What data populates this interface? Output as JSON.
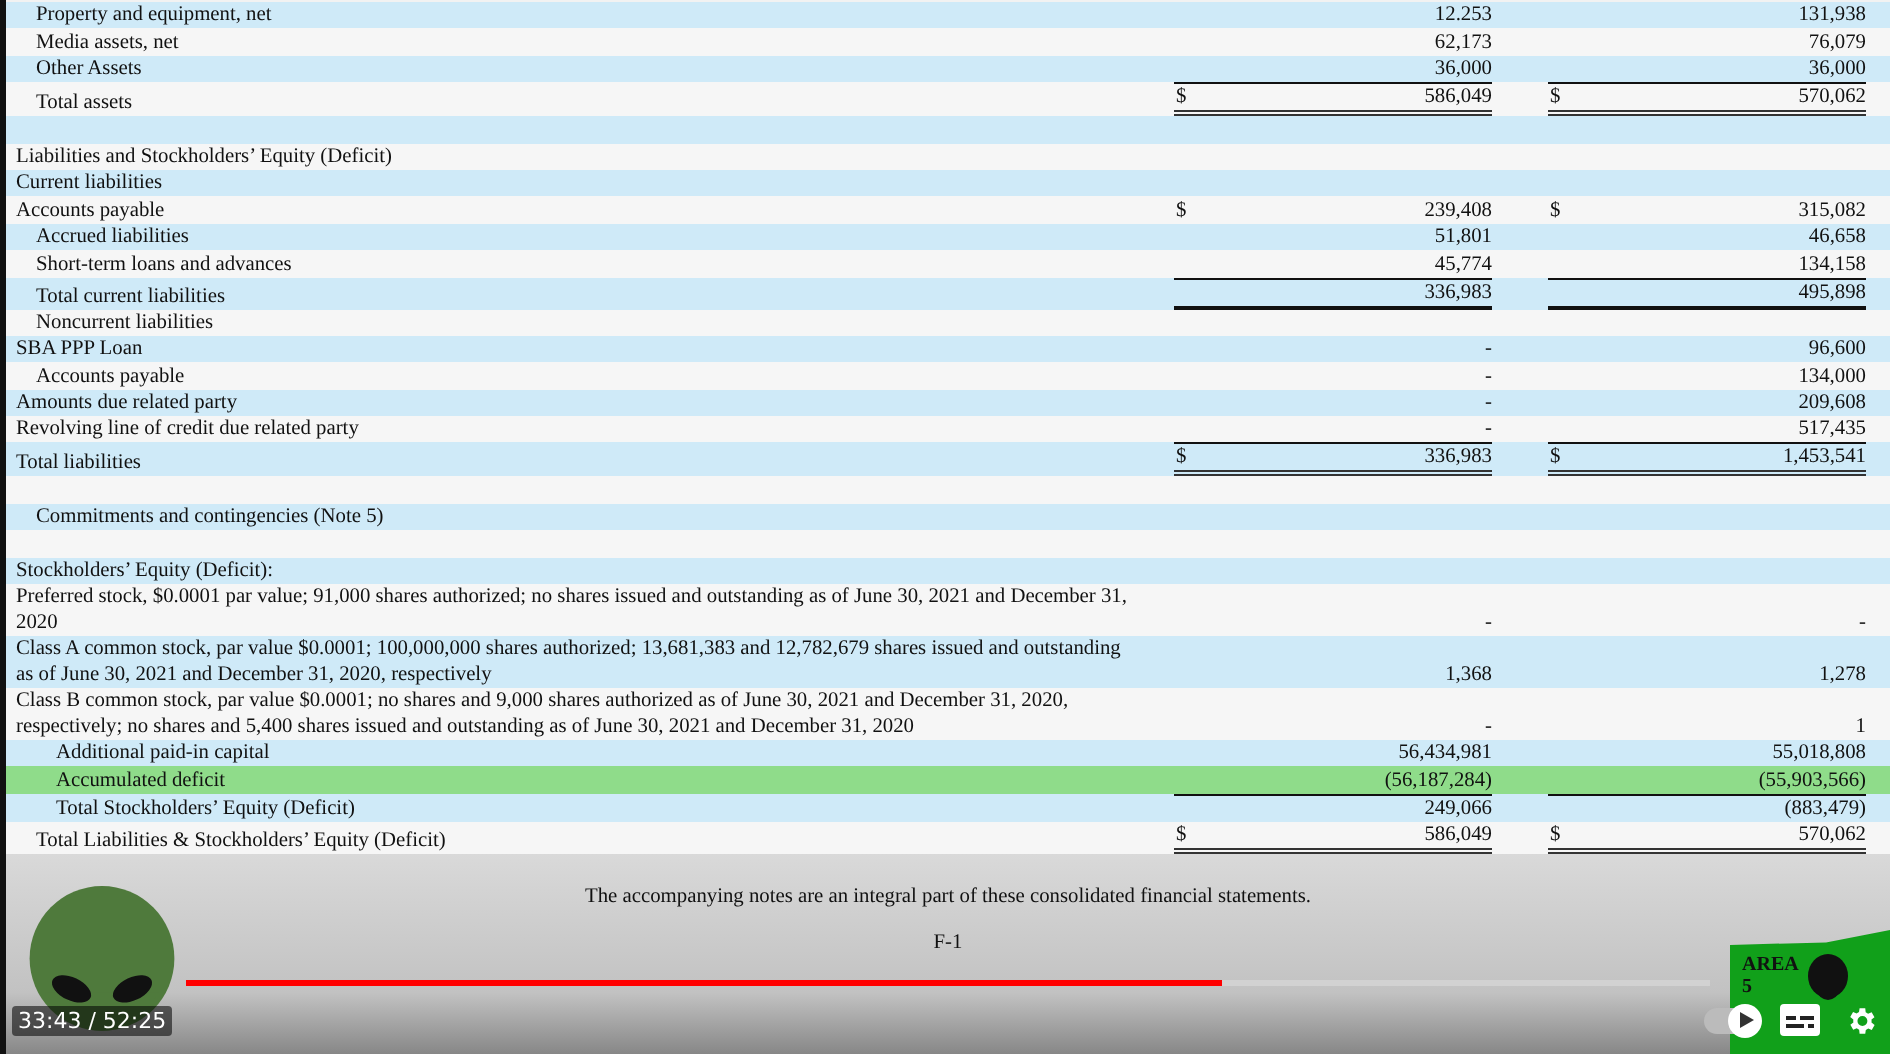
{
  "statement": {
    "rows": [
      {
        "kind": "item",
        "label": "Property and equipment, net",
        "band": true,
        "highlighted": false,
        "col_1": {
          "value": "12.253",
          "rule_above": false,
          "rule_below": false,
          "double_underline": false
        },
        "col_2": {
          "value": "131,938",
          "rule_above": false,
          "rule_below": false,
          "double_underline": false
        }
      },
      {
        "kind": "item",
        "label": "Media assets, net",
        "band": false,
        "highlighted": false,
        "col_1": {
          "value": "62,173",
          "rule_above": false,
          "rule_below": false,
          "double_underline": false
        },
        "col_2": {
          "value": "76,079",
          "rule_above": false,
          "rule_below": false,
          "double_underline": false
        }
      },
      {
        "kind": "item",
        "label": "Other Assets",
        "band": true,
        "highlighted": false,
        "col_1": {
          "value": "36,000",
          "rule_above": false,
          "rule_below": false,
          "double_underline": false
        },
        "col_2": {
          "value": "36,000",
          "rule_above": false,
          "rule_below": false,
          "double_underline": false
        }
      },
      {
        "kind": "item",
        "label": "Total assets",
        "band": false,
        "highlighted": false,
        "col_1": {
          "currency": "$",
          "value": "586,049",
          "rule_above": true,
          "rule_below": false,
          "double_underline": true
        },
        "col_2": {
          "currency": "$",
          "value": "570,062",
          "rule_above": true,
          "rule_below": false,
          "double_underline": true
        }
      },
      {
        "kind": "spacer",
        "band": true,
        "highlighted": false
      },
      {
        "kind": "heading",
        "label": "Liabilities and Stockholders’ Equity (Deficit)",
        "band": false,
        "highlighted": false
      },
      {
        "kind": "heading",
        "label": "Current liabilities",
        "band": true,
        "highlighted": false
      },
      {
        "kind": "heading",
        "label": "Accounts payable",
        "band": false,
        "highlighted": false,
        "col_1": {
          "currency": "$",
          "value": "239,408",
          "rule_above": false,
          "rule_below": false,
          "double_underline": false
        },
        "col_2": {
          "currency": "$",
          "value": "315,082",
          "rule_above": false,
          "rule_below": false,
          "double_underline": false
        }
      },
      {
        "kind": "item",
        "label": "Accrued liabilities",
        "band": true,
        "highlighted": false,
        "col_1": {
          "value": "51,801",
          "rule_above": false,
          "rule_below": false,
          "double_underline": false
        },
        "col_2": {
          "value": "46,658",
          "rule_above": false,
          "rule_below": false,
          "double_underline": false
        }
      },
      {
        "kind": "item",
        "label": "Short-term loans and advances",
        "band": false,
        "highlighted": false,
        "col_1": {
          "value": "45,774",
          "rule_above": false,
          "rule_below": false,
          "double_underline": false
        },
        "col_2": {
          "value": "134,158",
          "rule_above": false,
          "rule_below": false,
          "double_underline": false
        }
      },
      {
        "kind": "item",
        "label": "Total current liabilities",
        "band": true,
        "highlighted": false,
        "col_1": {
          "value": "336,983",
          "rule_above": true,
          "rule_below": true,
          "double_underline": false
        },
        "col_2": {
          "value": "495,898",
          "rule_above": true,
          "rule_below": true,
          "double_underline": false
        }
      },
      {
        "kind": "item",
        "label": "Noncurrent liabilities",
        "band": false,
        "highlighted": false
      },
      {
        "kind": "heading",
        "label": "SBA PPP Loan",
        "band": true,
        "highlighted": false,
        "col_1": {
          "value": "-",
          "rule_above": false,
          "rule_below": false,
          "double_underline": false
        },
        "col_2": {
          "value": "96,600",
          "rule_above": false,
          "rule_below": false,
          "double_underline": false
        }
      },
      {
        "kind": "item",
        "label": "Accounts payable",
        "band": false,
        "highlighted": false,
        "col_1": {
          "value": "-",
          "rule_above": false,
          "rule_below": false,
          "double_underline": false
        },
        "col_2": {
          "value": "134,000",
          "rule_above": false,
          "rule_below": false,
          "double_underline": false
        }
      },
      {
        "kind": "heading",
        "label": "Amounts due related party",
        "band": true,
        "highlighted": false,
        "col_1": {
          "value": "-",
          "rule_above": false,
          "rule_below": false,
          "double_underline": false
        },
        "col_2": {
          "value": "209,608",
          "rule_above": false,
          "rule_below": false,
          "double_underline": false
        }
      },
      {
        "kind": "heading",
        "label": "Revolving line of credit due related party",
        "band": false,
        "highlighted": false,
        "col_1": {
          "value": "-",
          "rule_above": false,
          "rule_below": false,
          "double_underline": false
        },
        "col_2": {
          "value": "517,435",
          "rule_above": false,
          "rule_below": false,
          "double_underline": false
        }
      },
      {
        "kind": "heading",
        "label": "Total liabilities",
        "band": true,
        "highlighted": false,
        "col_1": {
          "currency": "$",
          "value": "336,983",
          "rule_above": true,
          "rule_below": false,
          "double_underline": true
        },
        "col_2": {
          "currency": "$",
          "value": "1,453,541",
          "rule_above": true,
          "rule_below": false,
          "double_underline": true
        }
      },
      {
        "kind": "spacer",
        "band": false,
        "highlighted": false
      },
      {
        "kind": "item",
        "label": "Commitments and contingencies (Note 5)",
        "band": true,
        "highlighted": false
      },
      {
        "kind": "spacer",
        "band": false,
        "highlighted": false
      },
      {
        "kind": "heading",
        "label": "Stockholders’ Equity (Deficit):",
        "band": true,
        "highlighted": false
      },
      {
        "kind": "heading",
        "label": "Preferred stock, $0.0001 par value; 91,000 shares authorized; no shares issued and outstanding as of June 30, 2021 and December 31, 2020",
        "band": false,
        "highlighted": false,
        "col_1": {
          "value": "-",
          "rule_above": false,
          "rule_below": false,
          "double_underline": false
        },
        "col_2": {
          "value": "-",
          "rule_above": false,
          "rule_below": false,
          "double_underline": false
        }
      },
      {
        "kind": "heading",
        "label": "Class A common stock, par value $0.0001; 100,000,000 shares authorized; 13,681,383 and 12,782,679 shares issued and outstanding as of June 30, 2021 and December 31, 2020, respectively",
        "band": true,
        "highlighted": false,
        "col_1": {
          "value": "1,368",
          "rule_above": false,
          "rule_below": false,
          "double_underline": false
        },
        "col_2": {
          "value": "1,278",
          "rule_above": false,
          "rule_below": false,
          "double_underline": false
        }
      },
      {
        "kind": "heading",
        "label": "Class B common stock, par value $0.0001; no shares and 9,000 shares authorized as of June 30, 2021 and December 31, 2020, respectively; no shares and 5,400 shares issued and outstanding as of June 30, 2021 and December 31, 2020",
        "band": false,
        "highlighted": false,
        "col_1": {
          "value": "-",
          "rule_above": false,
          "rule_below": false,
          "double_underline": false
        },
        "col_2": {
          "value": "1",
          "rule_above": false,
          "rule_below": false,
          "double_underline": false
        }
      },
      {
        "kind": "subitem",
        "label": "Additional paid-in capital",
        "band": true,
        "highlighted": false,
        "col_1": {
          "value": "56,434,981",
          "rule_above": false,
          "rule_below": false,
          "double_underline": false
        },
        "col_2": {
          "value": "55,018,808",
          "rule_above": false,
          "rule_below": false,
          "double_underline": false
        }
      },
      {
        "kind": "subitem",
        "label": "Accumulated deficit",
        "band": false,
        "highlighted": true,
        "col_1": {
          "value": "(56,187,284)",
          "rule_above": false,
          "rule_below": false,
          "double_underline": false
        },
        "col_2": {
          "value": "(55,903,566)",
          "rule_above": false,
          "rule_below": false,
          "double_underline": false
        }
      },
      {
        "kind": "subitem",
        "label": "Total Stockholders’ Equity (Deficit)",
        "band": true,
        "highlighted": false,
        "col_1": {
          "value": "249,066",
          "rule_above": true,
          "rule_below": false,
          "double_underline": false
        },
        "col_2": {
          "value": "(883,479)",
          "rule_above": true,
          "rule_below": false,
          "double_underline": false
        }
      },
      {
        "kind": "item",
        "label": "Total Liabilities & Stockholders’ Equity (Deficit)",
        "band": false,
        "highlighted": false,
        "col_1": {
          "currency": "$",
          "value": "586,049",
          "rule_above": false,
          "rule_below": false,
          "double_underline": true
        },
        "col_2": {
          "currency": "$",
          "value": "570,062",
          "rule_above": false,
          "rule_below": false,
          "double_underline": true
        }
      }
    ],
    "note": "The accompanying notes are an integral part of these consolidated financial statements.",
    "page_number": "F-1"
  },
  "channel_logo": {
    "text": "AREA 5"
  },
  "player": {
    "progress": {
      "level": 0.68
    },
    "time": "33:43 / 52:25",
    "autoplay": true
  }
}
